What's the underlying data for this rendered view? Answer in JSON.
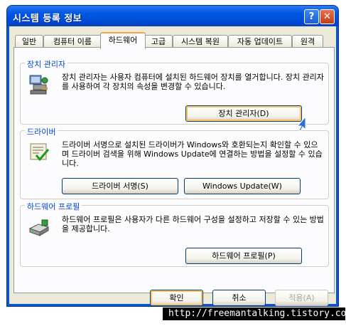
{
  "window": {
    "title": "시스템 등록 정보",
    "help_label": "?",
    "close_label": "✕"
  },
  "tabs": [
    {
      "label": "일반"
    },
    {
      "label": "컴퓨터 이름"
    },
    {
      "label": "하드웨어"
    },
    {
      "label": "고급"
    },
    {
      "label": "시스템 복원"
    },
    {
      "label": "자동 업데이트"
    },
    {
      "label": "원격"
    }
  ],
  "groups": {
    "device_manager": {
      "title": "장치 관리자",
      "text": "장치 관리자는 사용자 컴퓨터에 설치된 하드웨어 장치를 열거합니다. 장치 관리자를 사용하여 각 장치의 속성을 변경할 수 있습니다.",
      "button": "장치 관리자(D)",
      "icon": "device-manager-icon"
    },
    "drivers": {
      "title": "드라이버",
      "text": "드라이버 서명으로 설치된 드라이버가 Windows와 호환되는지 확인할 수 있으며 드라이버 검색을 위해 Windows Update에 연결하는 방법을 설정할 수 있습니다.",
      "button_signing": "드라이버 서명(S)",
      "button_update": "Windows Update(W)",
      "icon": "driver-signing-icon"
    },
    "hardware_profiles": {
      "title": "하드웨어 프로필",
      "text": "하드웨어 프로필은 사용자가 다른 하드웨어 구성을 설정하고 저장할 수 있는 방법을 제공합니다.",
      "button": "하드웨어 프로필(P)",
      "icon": "hardware-profile-icon"
    }
  },
  "dialog_buttons": {
    "ok": "확인",
    "cancel": "취소",
    "apply": "적용(A)"
  },
  "footer": {
    "url": "http://freemantalking.tistory.com/"
  }
}
